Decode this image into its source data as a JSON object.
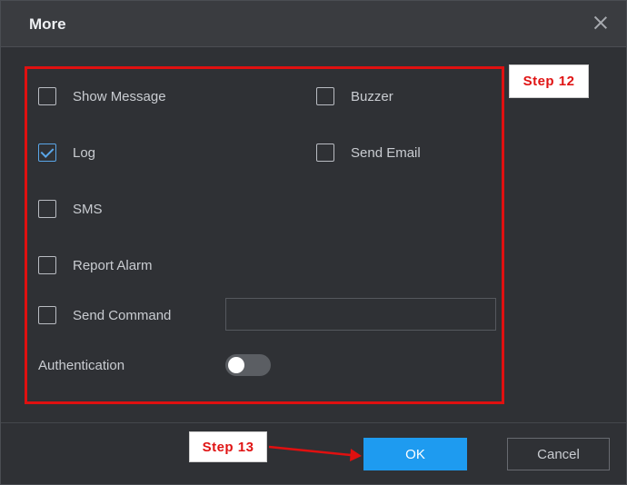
{
  "dialog": {
    "title": "More",
    "close_icon": "close-icon"
  },
  "options": {
    "show_message": {
      "label": "Show Message",
      "checked": false
    },
    "buzzer": {
      "label": "Buzzer",
      "checked": false
    },
    "log": {
      "label": "Log",
      "checked": true
    },
    "send_email": {
      "label": "Send Email",
      "checked": false
    },
    "sms": {
      "label": "SMS",
      "checked": false
    },
    "report_alarm": {
      "label": "Report Alarm",
      "checked": false
    },
    "send_command": {
      "label": "Send Command",
      "checked": false,
      "value": ""
    },
    "authentication": {
      "label": "Authentication",
      "enabled": false
    }
  },
  "annotations": {
    "step12": "Step 12",
    "step13": "Step 13",
    "highlight_color": "#e01010"
  },
  "footer": {
    "ok_label": "OK",
    "cancel_label": "Cancel"
  },
  "colors": {
    "accent": "#1e9bf0",
    "background": "#2f3135",
    "checkbox_checked": "#5aa6e8"
  }
}
